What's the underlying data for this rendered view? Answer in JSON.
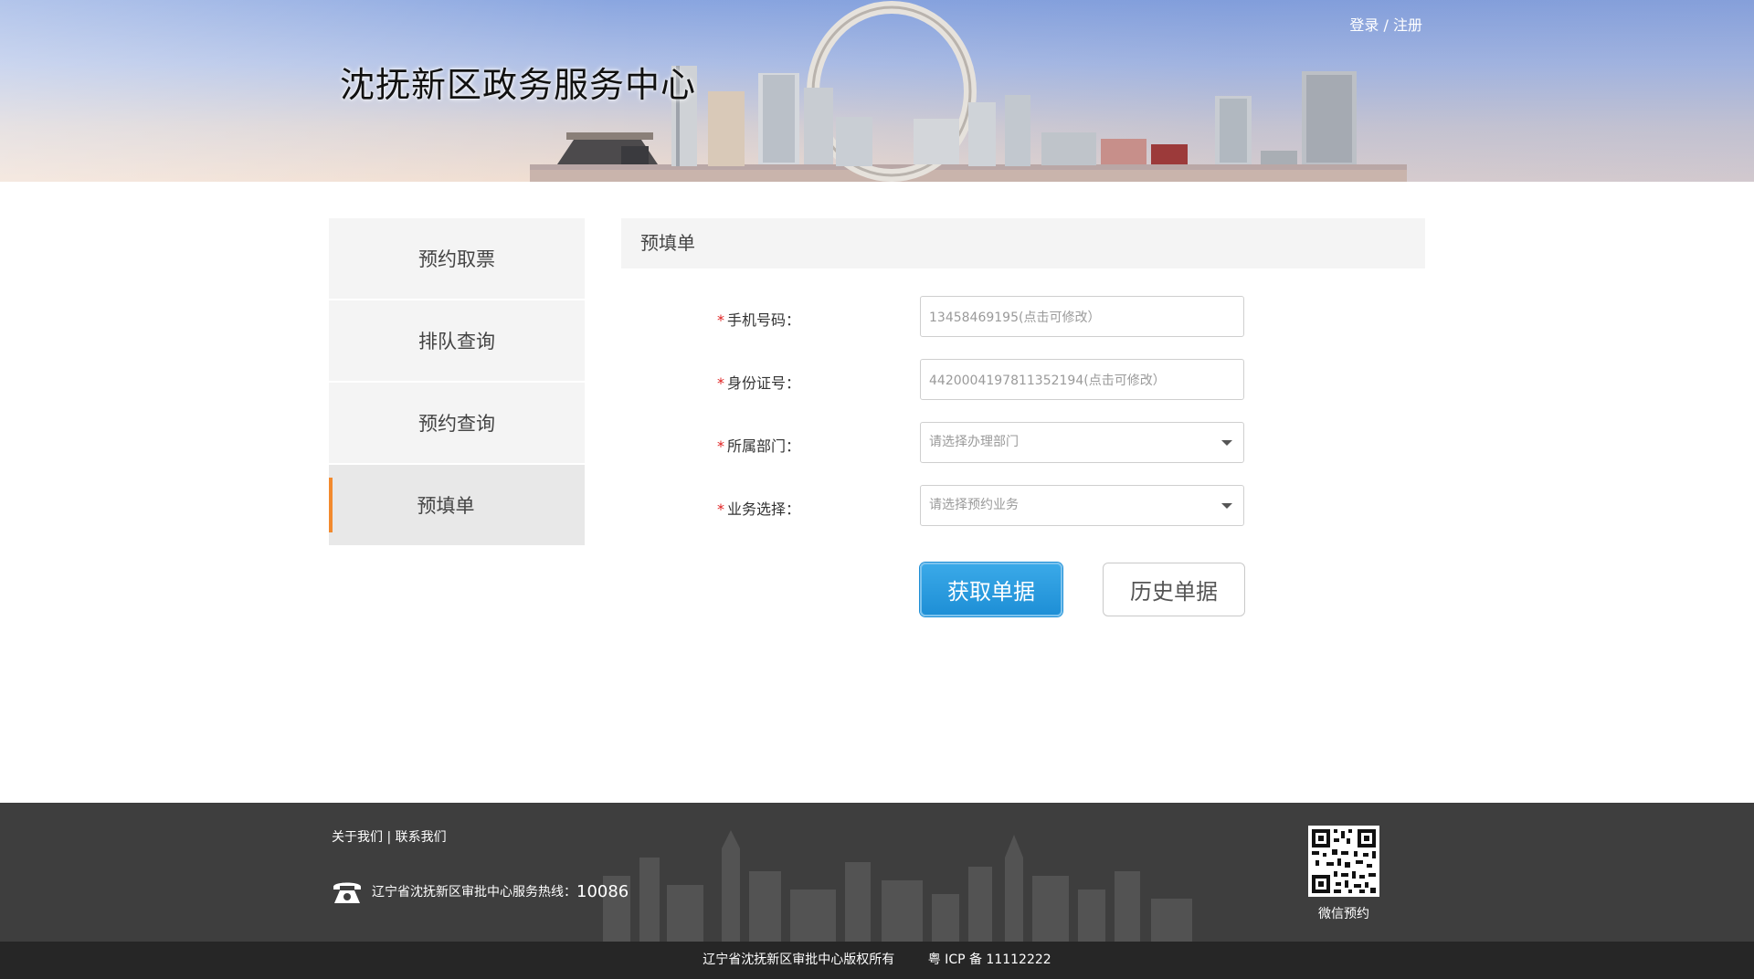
{
  "header": {
    "site_title": "沈抚新区政务服务中心",
    "login_label": "登录",
    "separator": "/",
    "register_label": "注册"
  },
  "sidebar": {
    "items": [
      {
        "label": "预约取票"
      },
      {
        "label": "排队查询"
      },
      {
        "label": "预约查询"
      },
      {
        "label": "预填单"
      }
    ],
    "active_index": 3
  },
  "panel": {
    "title": "预填单",
    "required_mark": "*",
    "fields": {
      "phone": {
        "label": "手机号码：",
        "value": "13458469195(点击可修改）"
      },
      "id_card": {
        "label": "身份证号：",
        "value": "4420004197811352194(点击可修改）"
      },
      "department": {
        "label": "所属部门：",
        "placeholder": "请选择办理部门"
      },
      "business": {
        "label": "业务选择：",
        "placeholder": "请选择预约业务"
      }
    },
    "buttons": {
      "get_form": "获取单据",
      "history": "历史单据"
    }
  },
  "footer": {
    "about_label": "关于我们",
    "divider": "|",
    "contact_label": "联系我们",
    "hotline_text": "辽宁省沈抚新区审批中心服务热线：",
    "hotline_number": "10086",
    "qr_label": "微信预约",
    "copyright": "辽宁省沈抚新区审批中心版权所有",
    "icp": "粤 ICP 备 11112222"
  },
  "colors": {
    "accent_orange": "#f28a2e",
    "primary_blue": "#1e8fd6",
    "required_red": "#e02020",
    "footer_bg": "#3e3e3e"
  }
}
